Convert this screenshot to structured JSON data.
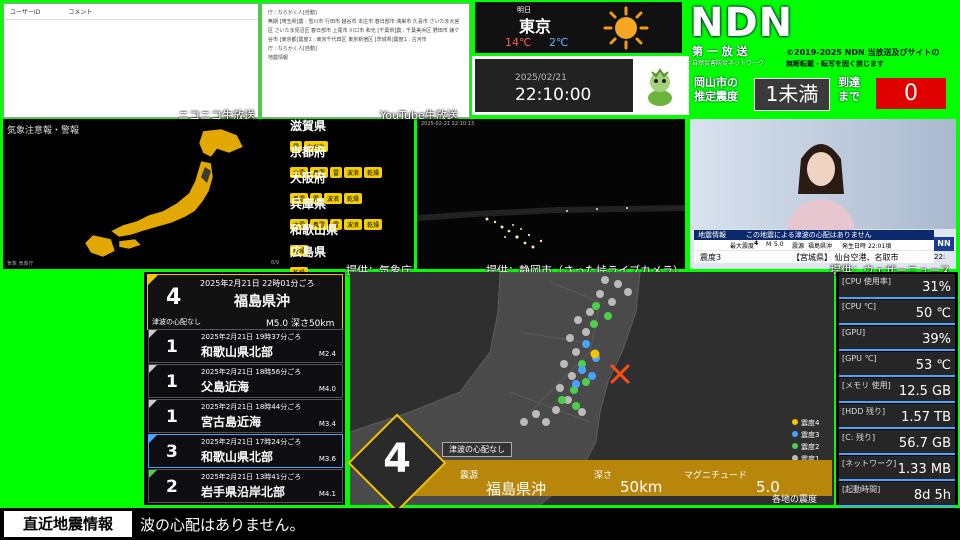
{
  "niconico": {
    "col_user": "ユーザーID",
    "col_comment": "コメント",
    "label": "ニコニコ生放送"
  },
  "youtube": {
    "text": "庁 : ならかく人[自動]\n無期 [埼玉県]震 : 雪川市 行田市 越谷市 本庄市 春日部市 鴻巣市 久喜市 さいたま大宮区 さいたま見沼区 春日部市 上尾市 川口市 和光 [千葉県]震 : 千葉美浜区 野田市 鎌ケ谷市 [東京都]震度1 : 東京千代田区 東京新宿区 [茨城県]震度1 : 古河市\n庁 : ならかく人[自動]\n地震情報",
    "label": "YouTube生放送"
  },
  "weather": {
    "day": "明日",
    "city": "東京",
    "high": "14℃",
    "low": "2℃",
    "icon": "sun-icon"
  },
  "clock": {
    "date": "2025/02/21",
    "time": "22:10:00"
  },
  "brand": {
    "logo": "NDN",
    "subtitle": "第 一 放 送",
    "subtitle2": "自然災害防災ネットワーク",
    "copyright1": "©2019-2025 NDN 当放送及びサイトの",
    "copyright2": "無断転載・転写を固く禁じます",
    "estimate_label1": "岡山市の",
    "estimate_label2": "推定震度",
    "estimate_value": "1未満",
    "arrival_label1": "到達",
    "arrival_label2": "まで",
    "arrival_value": "0"
  },
  "warnings": {
    "title": "気象注意報・警報",
    "footer_left": "気象 気象庁",
    "page": "6/9",
    "credit": "提供：気象庁",
    "prefectures": [
      {
        "name": "滋賀県",
        "tags": [
          "雷",
          "なだれ"
        ]
      },
      {
        "name": "京都府",
        "tags": [
          "大雪",
          "風雪",
          "雷",
          "波浪",
          "乾燥"
        ]
      },
      {
        "name": "大阪府",
        "tags": [
          "風雪",
          "雷",
          "波浪",
          "乾燥"
        ]
      },
      {
        "name": "兵庫県",
        "tags": [
          "大雪",
          "風雪",
          "雷",
          "波浪",
          "乾燥"
        ]
      },
      {
        "name": "和歌山県",
        "tags": [
          "乾燥"
        ]
      },
      {
        "name": "広島県",
        "tags": [
          "乾燥"
        ]
      }
    ]
  },
  "camera": {
    "timestamp": "2025-02-21 22:10:13",
    "credit": "提供：静岡市（さった峠ライブカメラ）"
  },
  "news": {
    "label": "地震情報",
    "headline": "この地震による津波の心配はありません",
    "max_int_label": "最大震度",
    "max_int": "4",
    "mag_label": "M",
    "mag": "5.0",
    "epicenter_label": "震源",
    "epicenter": "福島県沖",
    "time_label": "発生日時",
    "time": "22:01頃",
    "int_line_label": "震度3",
    "int_line": "【宮城県】 仙台空港、名取市",
    "logo": "NN",
    "clock": "22:",
    "credit": "提供：ウェザーニュース"
  },
  "latest": {
    "intensity": "4",
    "datetime": "2025年2月21日 22時01分ごろ",
    "place": "福島県沖",
    "tsunami": "津波の心配なし",
    "detail": "M5.0 深さ50km"
  },
  "history": [
    {
      "intensity": "1",
      "datetime": "2025年2月21日 19時37分ごろ",
      "place": "和歌山県北部",
      "mag": "M2.4",
      "color": "#cccccc"
    },
    {
      "intensity": "1",
      "datetime": "2025年2月21日 18時56分ごろ",
      "place": "父島近海",
      "mag": "M4.0",
      "color": "#cccccc"
    },
    {
      "intensity": "1",
      "datetime": "2025年2月21日 18時44分ごろ",
      "place": "宮古島近海",
      "mag": "M3.4",
      "color": "#cccccc"
    },
    {
      "intensity": "3",
      "datetime": "2025年2月21日 17時24分ごろ",
      "place": "和歌山県北部",
      "mag": "M3.6",
      "color": "#4aa3ff"
    },
    {
      "intensity": "2",
      "datetime": "2025年2月21日 13時41分ごろ",
      "place": "岩手県沿岸北部",
      "mag": "M4.1",
      "color": "#4bd04b"
    }
  ],
  "intensity_map": {
    "tsunami": "津波の心配なし",
    "intensity": "4",
    "epicenter_label": "震源",
    "epicenter": "福島県沖",
    "depth_label": "深さ",
    "depth": "50km",
    "mag_label": "マグニチュード",
    "mag": "5.0",
    "footer": "各地の震度",
    "legend": [
      {
        "label": "震度4",
        "color": "#f5c400"
      },
      {
        "label": "震度3",
        "color": "#4aa3ff"
      },
      {
        "label": "震度2",
        "color": "#4bd04b"
      },
      {
        "label": "震度1",
        "color": "#bbbbbb"
      }
    ]
  },
  "stats": [
    {
      "label": "[CPU 使用率]",
      "value": "31%"
    },
    {
      "label": "[CPU ℃]",
      "value": "50 ℃"
    },
    {
      "label": "[GPU]",
      "value": "39%"
    },
    {
      "label": "[GPU ℃]",
      "value": "53 ℃"
    },
    {
      "label": "[メモリ 使用]",
      "value": "12.5 GB"
    },
    {
      "label": "[HDD 残り]",
      "value": "1.57 TB"
    },
    {
      "label": "[C: 残り]",
      "value": "56.7 GB"
    },
    {
      "label": "[ネットワーク]",
      "value": "1.33 MB"
    },
    {
      "label": "[起動時間]",
      "value": "8d 5h"
    }
  ],
  "ticker": {
    "label": "直近地震情報",
    "text": "波の心配はありません。"
  },
  "colors": {
    "chroma": "#00ff00",
    "warning_yellow": "#f5c400",
    "arrival_red": "#e00000"
  }
}
